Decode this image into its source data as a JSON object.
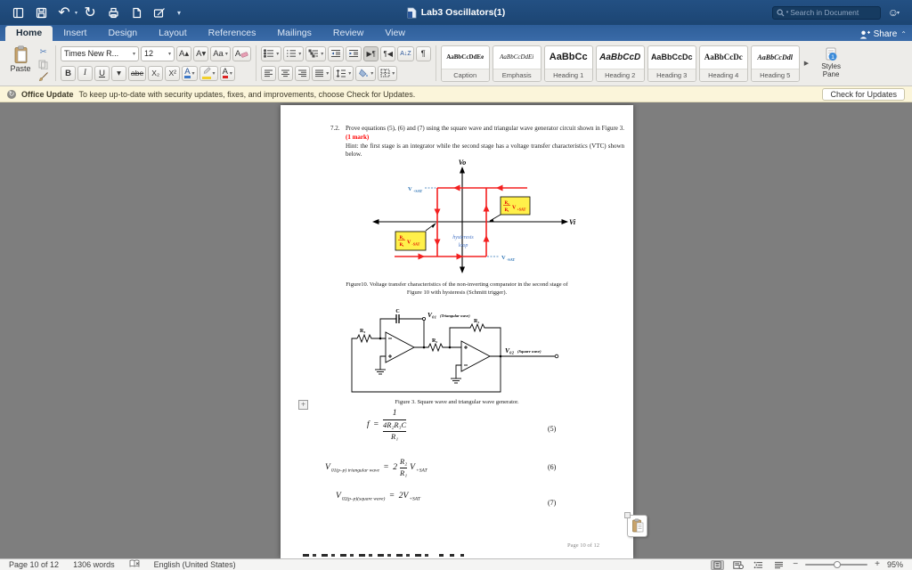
{
  "titlebar": {
    "title": "Lab3 Oscillators(1)",
    "search_placeholder": "Search in Document"
  },
  "tabs": [
    "Home",
    "Insert",
    "Design",
    "Layout",
    "References",
    "Mailings",
    "Review",
    "View"
  ],
  "share": {
    "label": "Share"
  },
  "icons": {
    "undo": "↶",
    "redo": "↻",
    "caret": "▾",
    "smiley": "☺",
    "scissors": "✂",
    "pilcrow": "¶",
    "pilcrow_ltr": "▶¶",
    "pilcrow_rtl": "¶◀",
    "sort_az": "A↓Z",
    "gallery_more": "▶",
    "share_caret": "⌃",
    "plus": "+",
    "update_badge": "↻"
  },
  "ribbon": {
    "paste_label": "Paste",
    "font_name": "Times New R...",
    "font_size": "12",
    "buttons": {
      "grow": "A▴",
      "shrink": "A▾",
      "case": "Aa",
      "clear": "A",
      "bold": "B",
      "italic": "I",
      "underline": "U",
      "strike": "abe",
      "subscript": "X₂",
      "superscript": "X²",
      "effects": "A",
      "color": "A"
    },
    "styles": [
      {
        "sample": "AaBbCcDdEe",
        "label": "Caption"
      },
      {
        "sample": "AaBbCcDdEi",
        "label": "Emphasis"
      },
      {
        "sample": "AaBbCc",
        "label": "Heading 1"
      },
      {
        "sample": "AaBbCcD",
        "label": "Heading 2"
      },
      {
        "sample": "AaBbCcDc",
        "label": "Heading 3"
      },
      {
        "sample": "AaBbCcDc",
        "label": "Heading 4"
      },
      {
        "sample": "AaBbCcDdl",
        "label": "Heading 5"
      }
    ],
    "styles_pane": "Styles Pane"
  },
  "update_bar": {
    "title": "Office Update",
    "message": "To keep up-to-date with security updates, fixes, and improvements, choose Check for Updates.",
    "button": "Check for Updates"
  },
  "document": {
    "section": "7.2.",
    "body": "Prove equations (5), (6) and (7) using the square wave and triangular wave generator circuit shown in Figure 3.",
    "mark": "(1 mark)",
    "hint": "Hint: the first stage is an integrator while the second stage has a voltage transfer characteristics (VTC) shown below.",
    "vtc": {
      "y_axis": "Vo",
      "x_axis": "Vi",
      "vpos_main": "V",
      "vpos_sub": "+SAT",
      "vneg_main": "V",
      "vneg_sub": "-SAT",
      "box_right_num": "R₂",
      "box_right_den": "R₁",
      "box_right_v": "V",
      "box_right_sub": "+SAT",
      "box_left_num": "R₂",
      "box_left_den": "R₁",
      "box_left_v": "V",
      "box_left_sub": "-SAT",
      "loop_word1": "hysteresis",
      "loop_word2": "loop"
    },
    "fig10_caption_l1": "Figure10. Voltage transfer characteristics of the non-inverting comparator in the second stage of",
    "fig10_caption_l2": "Figure 10 with hysteresis (Schmitt trigger).",
    "circuit": {
      "r3": "R₃",
      "c": "C",
      "r2": "R₂",
      "r1": "R₁",
      "vo1": "V₀₁",
      "vo1_note": "(Triangular wave)",
      "vo2": "V₀₂",
      "vo2_note": "(Square wave)"
    },
    "fig3_caption": "Figure 3. Square wave and triangular wave generator.",
    "eq5": {
      "lhs": "f",
      "rel": "=",
      "num": "1",
      "den_num": "4R₂R₃C",
      "den_den": "R₁",
      "tag": "(5)"
    },
    "eq6": {
      "lhs_main": "V",
      "lhs_sub": "01(p–p) triangular wave",
      "rel": "=",
      "coef": "2",
      "num": "R₂",
      "den": "R₁",
      "rhs_main": "V",
      "rhs_sub": "+SAT",
      "tag": "(6)"
    },
    "eq7": {
      "lhs_main": "V",
      "lhs_sub": "02(p–p)(square wave)",
      "rel": "=",
      "rhs_main": "2V",
      "rhs_sub": "+SAT",
      "tag": "(7)"
    },
    "footer": "Page 10 of 12"
  },
  "statusbar": {
    "page": "Page 10 of 12",
    "words": "1306 words",
    "language": "English (United States)",
    "zoom": "95%"
  },
  "colors": {
    "loop_red": "#F32020",
    "label_blue": "#2E74B5",
    "box_yellow": "#FFF04A",
    "box_text_red": "#E00000",
    "mark_red": "#FF0000"
  }
}
